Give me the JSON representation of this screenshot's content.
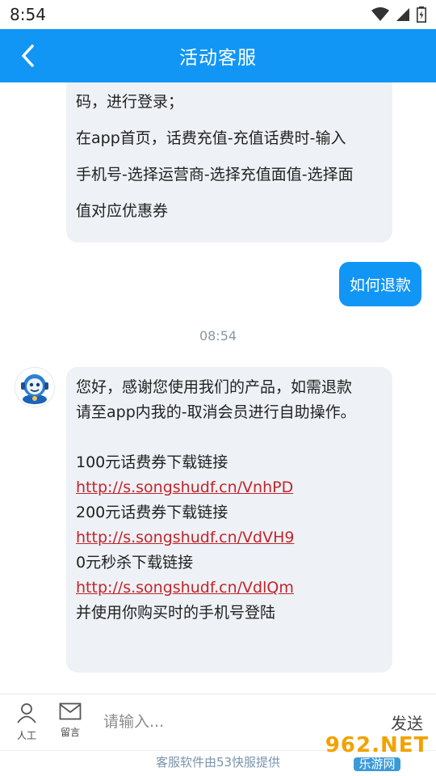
{
  "status_bar": {
    "time": "8:54"
  },
  "header": {
    "title": "活动客服"
  },
  "messages": {
    "agent_prev": [
      "码，进行登录；",
      "在app首页，话费充值-充值话费时-输入",
      "手机号-选择运营商-选择充值面值-选择面",
      "值对应优惠券"
    ],
    "user": "如何退款",
    "timestamp": "08:54",
    "agent_reply": {
      "greeting_1": "您好，感谢您使用我们的产品，如需退款",
      "greeting_2": "请至app内我的-取消会员进行自助操作。",
      "label_100": "100元话费券下载链接",
      "link_100": "http://s.songshudf.cn/VnhPD",
      "label_200": "200元话费券下载链接",
      "link_200": "http://s.songshudf.cn/VdVH9",
      "label_0": "0元秒杀下载链接",
      "link_0": "http://s.songshudf.cn/VdlQm",
      "closing": "并使用你购买时的手机号登陆"
    }
  },
  "input_bar": {
    "human_label": "人工",
    "message_label": "留言",
    "placeholder": "请输入...",
    "send_label": "发送"
  },
  "footer": {
    "text": "客服软件由53快服提供"
  },
  "watermark": {
    "line1": "962.NET",
    "line2": "乐游网"
  },
  "colors": {
    "accent": "#1296f5",
    "link": "#c0262d",
    "bubble_bg": "#eef1f5"
  }
}
